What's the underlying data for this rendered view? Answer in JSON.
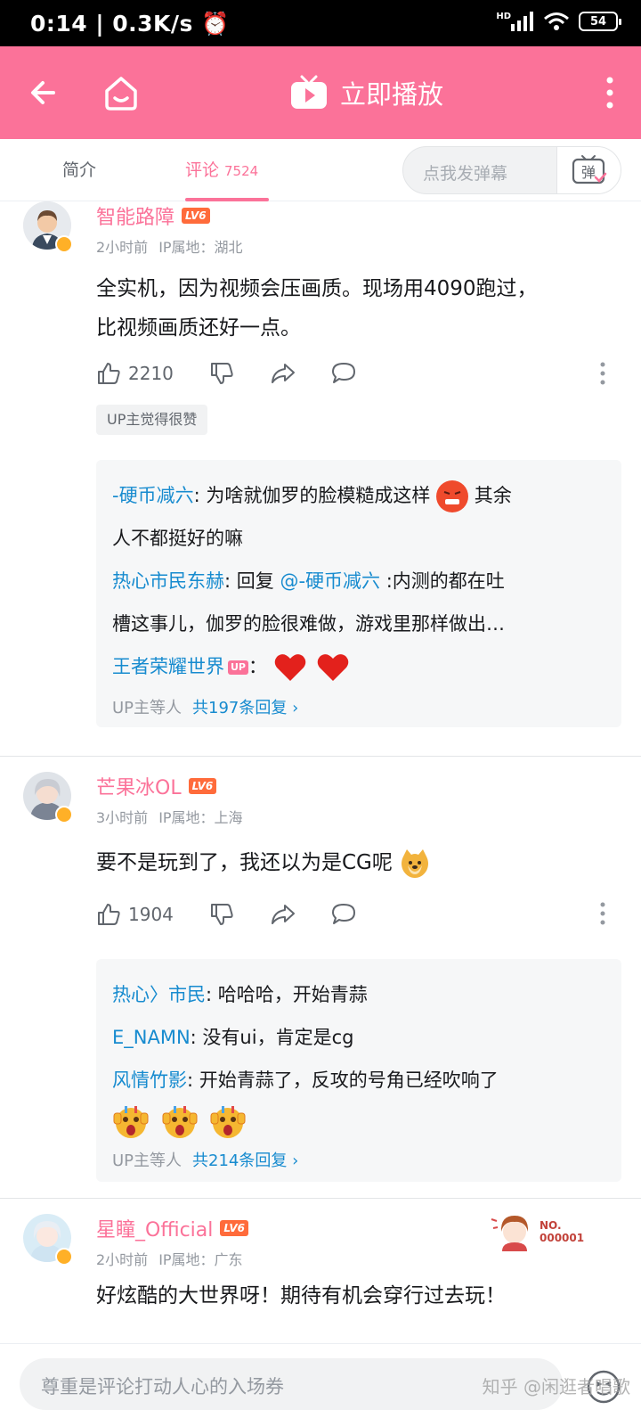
{
  "status_bar": {
    "time": "0:14",
    "speed": "0.3K/s",
    "network": "HD",
    "battery": "54"
  },
  "topbar": {
    "play_label": "立即播放"
  },
  "tabs": {
    "intro": "简介",
    "comments": "评论",
    "comment_count": "7524",
    "danmaku_placeholder": "点我发弹幕",
    "danmaku_button": "弹"
  },
  "comments": [
    {
      "user": "智能路障",
      "level": "LV6",
      "time": "2小时前",
      "ip": "IP属地：湖北",
      "content_line1": "全实机，因为视频会压画质。现场用4090跑过，",
      "content_line2": "比视频画质还好一点。",
      "likes": "2210",
      "up_liked": "UP主觉得很赞",
      "replies": [
        {
          "name": "-硬币减六",
          "text": ": 为啥就伽罗的脸模糙成这样",
          "text2": " 其余",
          "line2": "人不都挺好的嘛"
        },
        {
          "name": "热心市民东赫",
          "text": ": 回复 ",
          "mention": "@-硬币减六",
          "text2": " :内测的都在吐",
          "line2": "槽这事儿，伽罗的脸很难做，游戏里那样做出…"
        },
        {
          "name": "王者荣耀世界",
          "tag": "UP",
          "text": "："
        }
      ],
      "more_prefix": "UP主等人",
      "more_total": "共197条回复 ›"
    },
    {
      "user": "芒果冰OL",
      "level": "LV6",
      "time": "3小时前",
      "ip": "IP属地：上海",
      "content_line1": "要不是玩到了，我还以为是CG呢",
      "likes": "1904",
      "replies": [
        {
          "name": "热心〉市民",
          "text": ": 哈哈哈，开始青蒜"
        },
        {
          "name": "E_NAMN",
          "text": ": 没有ui，肯定是cg"
        },
        {
          "name": "风情竹影",
          "text": ": 开始青蒜了，反攻的号角已经吹响了"
        }
      ],
      "more_prefix": "UP主等人",
      "more_total": "共214条回复 ›"
    },
    {
      "user": "星瞳_Official",
      "level": "LV6",
      "time": "2小时前",
      "ip": "IP属地：广东",
      "content_line1": "好炫酷的大世界呀！期待有机会穿行过去玩！",
      "badge_no": "NO.",
      "badge_num": "000001"
    }
  ],
  "bottom": {
    "placeholder": "尊重是评论打动人心的入场券"
  },
  "watermark": "知乎 @闲逛者唱歌",
  "colors": {
    "pink": "#fb7299",
    "reply_name": "#178bcf",
    "level_orange": "#ff6b3b"
  }
}
